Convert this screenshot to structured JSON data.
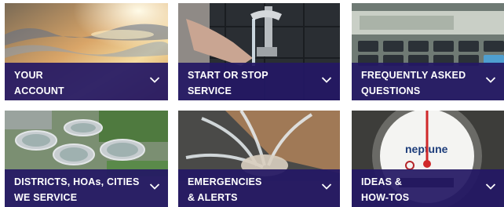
{
  "tiles": [
    {
      "line1": "YOUR",
      "line2": "ACCOUNT",
      "chevron_icon": "chevron-down-icon"
    },
    {
      "line1": "START OR STOP",
      "line2": "SERVICE",
      "chevron_icon": "chevron-down-icon"
    },
    {
      "line1": "FREQUENTLY ASKED",
      "line2": "QUESTIONS",
      "chevron_icon": "chevron-down-icon"
    },
    {
      "line1": "DISTRICTS, HOAs, CITIES",
      "line2": "WE SERVICE",
      "chevron_icon": "chevron-down-icon"
    },
    {
      "line1": "EMERGENCIES",
      "line2": "& ALERTS",
      "chevron_icon": "chevron-down-icon"
    },
    {
      "line1": "IDEAS &",
      "line2": "HOW-TOS",
      "chevron_icon": "chevron-down-icon"
    }
  ],
  "meter_brand": "neptune",
  "colors": {
    "band": "#241864",
    "text": "#ffffff"
  }
}
